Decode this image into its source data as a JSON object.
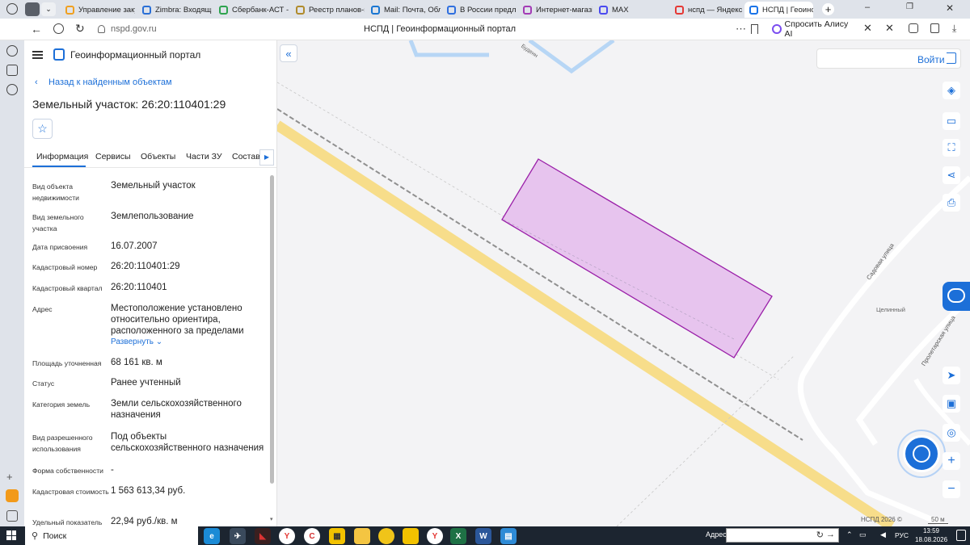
{
  "browser": {
    "tabs": [
      {
        "label": "Управление заку",
        "color": "#f0a020"
      },
      {
        "label": "Zimbra: Входящи",
        "color": "#2a6fd6"
      },
      {
        "label": "Сбербанк-АСТ -",
        "color": "#2ea44f"
      },
      {
        "label": "Реестр планов-гр",
        "color": "#b08b2c"
      },
      {
        "label": "Mail: Почта, Обла",
        "color": "#1976d2"
      },
      {
        "label": "В России предло",
        "color": "#2f6fdf"
      },
      {
        "label": "Интернет-магазі",
        "color": "#a33bb5"
      },
      {
        "label": "MAX",
        "color": "#4a4af0"
      },
      {
        "label": "нспд — Яндекс: н",
        "color": "#e53935"
      },
      {
        "label": "НСПД | Геоинс",
        "color": "#1a73e8"
      }
    ],
    "url": "nspd.gov.ru",
    "page_title": "НСПД | Геоинформационный портал",
    "alice_label": "Спросить Алису AI"
  },
  "panel": {
    "portal_title": "Геоинформационный портал",
    "back_link": "Назад к найденным объектам",
    "object_title": "Земельный участок: 26:20:110401:29",
    "tabs": [
      "Информация",
      "Сервисы",
      "Объекты",
      "Части ЗУ",
      "Состав"
    ],
    "rows": [
      {
        "label": "Вид объекта недвижимости",
        "value": "Земельный участок"
      },
      {
        "label": "Вид земельного участка",
        "value": "Землепользование"
      },
      {
        "label": "Дата присвоения",
        "value": "16.07.2007"
      },
      {
        "label": "Кадастровый номер",
        "value": "26:20:110401:29"
      },
      {
        "label": "Кадастровый квартал",
        "value": "26:20:110401"
      },
      {
        "label": "Адрес",
        "value": "Местоположение установлено относительно ориентира, расположенного за пределами"
      },
      {
        "label": "Площадь уточненная",
        "value": "68 161 кв. м"
      },
      {
        "label": "Статус",
        "value": "Ранее учтенный"
      },
      {
        "label": "Категория земель",
        "value": "Земли сельскохозяйственного назначения"
      },
      {
        "label": "Вид разрешенного использования",
        "value": "Под объекты сельскохозяйственного назначения"
      },
      {
        "label": "Форма собственности",
        "value": "-"
      },
      {
        "label": "Кадастровая стоимость",
        "value": "1 563 613,34 руб."
      },
      {
        "label": "Удельный показатель",
        "value": "22,94 руб./кв. м"
      }
    ],
    "expand_link": "Развернуть"
  },
  "map": {
    "login_label": "Войти",
    "street_1": "Садовая улица",
    "street_2": "Пролетарская улица",
    "street_3": "Буденн",
    "place": "Целинный",
    "copyright": "НСПД 2026 ©",
    "scale": "50 м",
    "parcel_fill": "#e7c4ee",
    "parcel_stroke": "#9a1fa8"
  },
  "taskbar": {
    "search_label": "Поиск",
    "address_label": "Адрес",
    "lang": "РУС",
    "time": "13:59",
    "date": "18.08.2026"
  },
  "colors": {
    "accent": "#1c6fd8",
    "road": "#f7dd8a"
  }
}
